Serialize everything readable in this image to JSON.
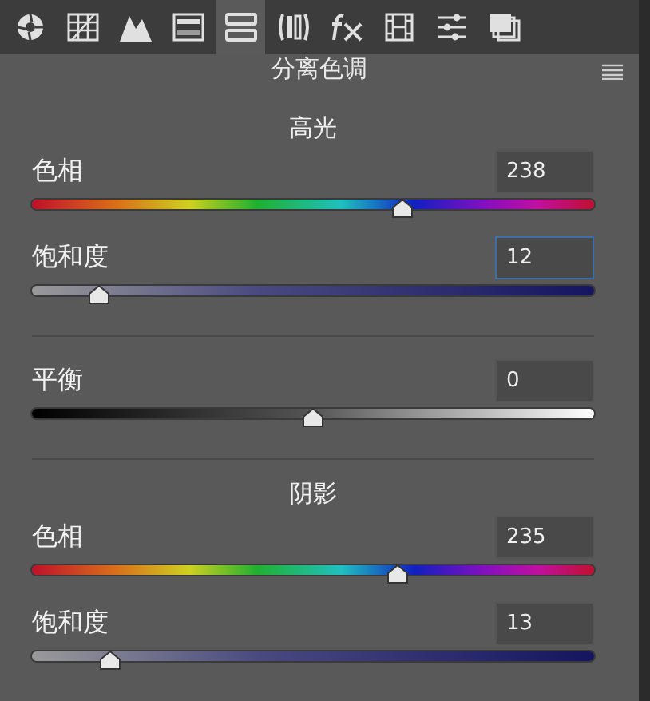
{
  "toolbar": {
    "tabs": [
      {
        "kind": "aperture",
        "selected": false
      },
      {
        "kind": "grid",
        "selected": false
      },
      {
        "kind": "peaks",
        "selected": false
      },
      {
        "kind": "bars",
        "selected": false
      },
      {
        "kind": "split",
        "selected": true
      },
      {
        "kind": "lens",
        "selected": false
      },
      {
        "kind": "fx",
        "selected": false
      },
      {
        "kind": "film",
        "selected": false
      },
      {
        "kind": "sliders",
        "selected": false
      },
      {
        "kind": "stack",
        "selected": false
      }
    ]
  },
  "panel": {
    "title": "分离色调",
    "sections": [
      {
        "heading": "高光",
        "rows": [
          {
            "kind": "hue",
            "label": "色相",
            "value": "238",
            "level": 0.66,
            "focused": false
          },
          {
            "kind": "saturation",
            "label": "饱和度",
            "value": "12",
            "level": 0.12,
            "focused": true
          }
        ]
      },
      {
        "rows": [
          {
            "kind": "balance",
            "label": "平衡",
            "value": "0",
            "level": 0.5,
            "focused": false
          }
        ]
      },
      {
        "heading": "阴影",
        "rows": [
          {
            "kind": "hue",
            "label": "色相",
            "value": "235",
            "level": 0.65,
            "focused": false
          },
          {
            "kind": "saturation",
            "label": "饱和度",
            "value": "13",
            "level": 0.14,
            "focused": false
          }
        ]
      }
    ]
  }
}
